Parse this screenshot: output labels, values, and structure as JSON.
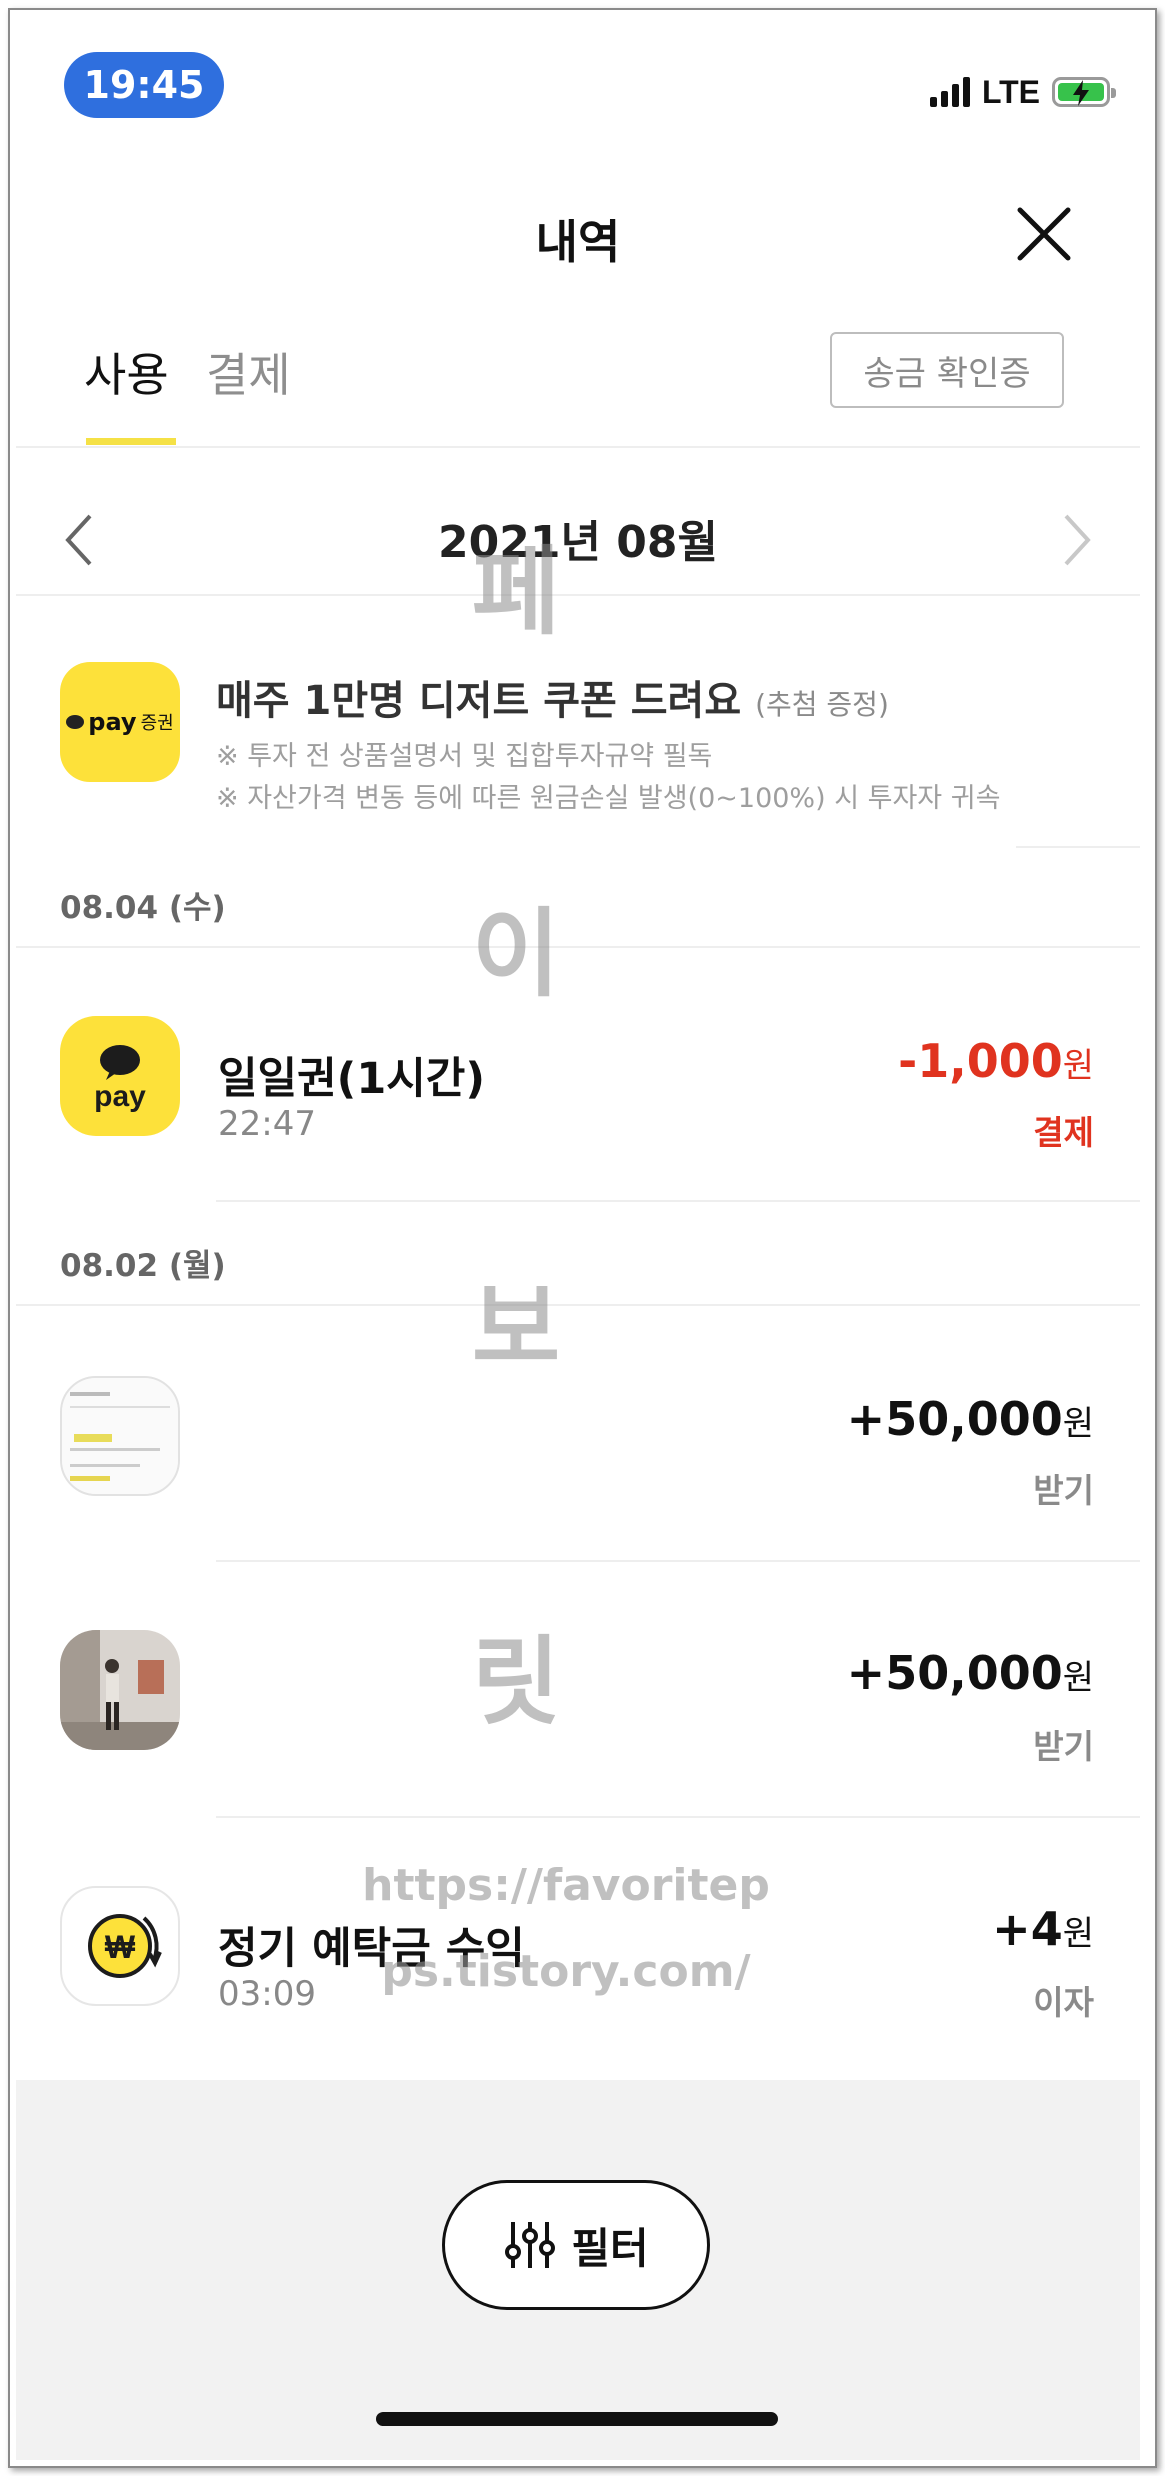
{
  "status_bar": {
    "time": "19:45",
    "network": "LTE"
  },
  "header": {
    "title": "내역"
  },
  "tabs": [
    {
      "label": "사용",
      "active": true
    },
    {
      "label": "결제",
      "active": false
    }
  ],
  "remit_button": "송금 확인증",
  "month": "2021년 08월",
  "banner": {
    "logo_pay": "pay",
    "logo_sec": "증권",
    "title": "매주 1만명 디저트 쿠폰 드려요",
    "title_small": "(추첨 증정)",
    "note1": "※ 투자 전 상품설명서 및 집합투자규약 필독",
    "note2": "※ 자산가격 변동 등에 따른 원금손실 발생(0~100%) 시 투자자 귀속"
  },
  "groups": [
    {
      "date": "08.04 (수)",
      "items": [
        {
          "title": "일일권(1시간)",
          "time": "22:47",
          "amount": "-1,000",
          "unit": "원",
          "kind": "결제",
          "icon": "kakaopay-icon"
        }
      ]
    },
    {
      "date": "08.02 (월)",
      "items": [
        {
          "title": "",
          "time": "",
          "amount": "+50,000",
          "unit": "원",
          "kind": "받기",
          "icon": "profile-photo-1"
        },
        {
          "title": "",
          "time": "",
          "amount": "+50,000",
          "unit": "원",
          "kind": "받기",
          "icon": "profile-photo-2"
        },
        {
          "title": "정기 예탁금 수익",
          "time": "03:09",
          "amount": "+4",
          "unit": "원",
          "kind": "이자",
          "icon": "won-coin-icon"
        }
      ]
    }
  ],
  "filter_button": "필터",
  "watermark": {
    "c1": "페",
    "c2": "이",
    "c3": "보",
    "c4": "릿",
    "url1": "https://favoritep",
    "url2": "ps.tistory.com/"
  },
  "colors": {
    "accent_yellow": "#fde13a",
    "negative_red": "#e0331f",
    "status_blue": "#2f6fde"
  }
}
